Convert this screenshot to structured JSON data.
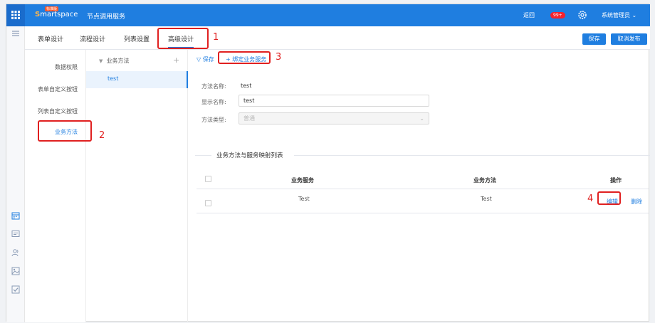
{
  "topbar": {
    "logo_text": "martspace",
    "logo_s": "S",
    "logo_badge": "标准版",
    "app_title": "节点调用服务",
    "back_label": "返回",
    "notif_count": "99+",
    "user_label": "系统管理员 ⌄"
  },
  "tabs": [
    {
      "label": "表单设计"
    },
    {
      "label": "流程设计"
    },
    {
      "label": "列表设置"
    },
    {
      "label": "高级设计"
    }
  ],
  "actions": {
    "save": "保存",
    "unpublish": "取消发布"
  },
  "sidebar": {
    "items": [
      {
        "label": "数据权限"
      },
      {
        "label": "表单自定义按钮"
      },
      {
        "label": "列表自定义按钮"
      },
      {
        "label": "业务方法"
      }
    ]
  },
  "methods": {
    "header": "业务方法",
    "selected": "test"
  },
  "toolbar": {
    "save": "保存",
    "bind": "绑定业务服务"
  },
  "form": {
    "method_name_label": "方法名称:",
    "method_name_value": "test",
    "display_name_label": "显示名称:",
    "display_name_value": "test",
    "method_type_label": "方法类型:",
    "method_type_value": "普通"
  },
  "mapping": {
    "title": "业务方法与服务映射列表",
    "columns": [
      "业务服务",
      "业务方法",
      "操作"
    ],
    "rows": [
      {
        "service": "Test",
        "method": "Test",
        "edit": "编辑",
        "delete": "删除"
      }
    ]
  },
  "annotations": [
    "1",
    "2",
    "3",
    "4"
  ],
  "colors": {
    "primary": "#1f7ee0",
    "annotation": "#e02020"
  }
}
